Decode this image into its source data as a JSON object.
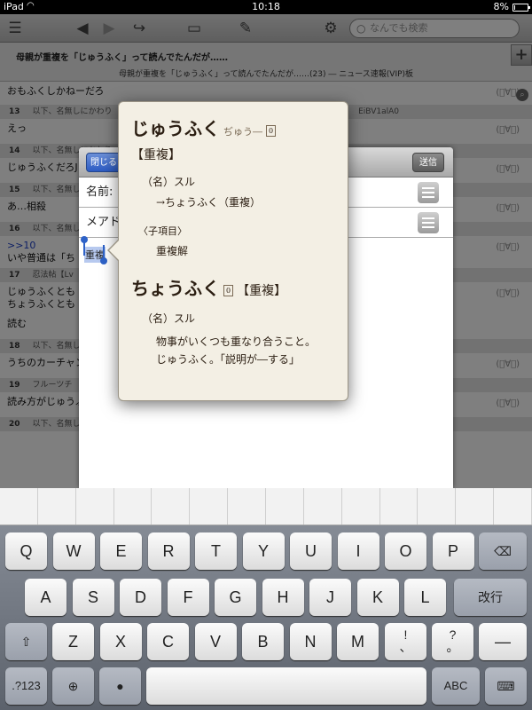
{
  "status": {
    "carrier": "iPad",
    "time": "10:18",
    "battery": "8%",
    "battery_level": 0.08
  },
  "toolbar": {
    "search_placeholder": "なんでも検索"
  },
  "thread": {
    "title": "母親が重複を「じゅうふく」って読んでたんだが……",
    "subtitle": "母親が重複を「じゅうふく」って読んでたんだが……(23) ― ニュース速報(VIP)板"
  },
  "posts": [
    {
      "head": null,
      "body": "おもふくしかねーだろ"
    },
    {
      "num": "13",
      "name": "以下、名無しにかわり",
      "pid": "EiBV1alA0",
      "body": "えっ"
    },
    {
      "num": "14",
      "name": "以下、名無しにかわり",
      "pid": "",
      "body": "じゅうふくだろJ"
    },
    {
      "num": "15",
      "name": "以下、名無しにかわり",
      "pid": "",
      "body": "あ…相殺"
    },
    {
      "num": "16",
      "name": "以下、名無しにかわり",
      "pid": "",
      "anchor": ">>10",
      "body": "いや普通は「ち"
    },
    {
      "num": "17",
      "name": "忍法帖【Lv",
      "pid": "",
      "body": "じゅうふくとも\nちょうふくとも"
    },
    {
      "num": "",
      "name": "",
      "pid": "",
      "body": "読む"
    },
    {
      "num": "18",
      "name": "以下、名無しにかわり",
      "pid": "",
      "body": "うちのカーチャン"
    },
    {
      "num": "19",
      "name": "フルーツチ",
      "pid": "",
      "body": "読み方がじゅうふ"
    },
    {
      "num": "20",
      "name": "以下、名無しにかわり",
      "pid": "",
      "body": ""
    }
  ],
  "compose": {
    "close_label": "閉じる",
    "send_label": "送信",
    "name_label": "名前:",
    "mail_label": "メアド",
    "body_text": "重複"
  },
  "dictionary": {
    "entry1": {
      "headword": "じゅうふく",
      "alt_reading": "ぢゅう―",
      "num": "0",
      "kanji": "【重複】",
      "pos": "（名）スル",
      "ref": "→ちょうふく（重複）",
      "sub_header": "〈子項目〉",
      "sub_item": "重複解"
    },
    "entry2": {
      "headword": "ちょうふく",
      "num": "0",
      "kanji": "【重複】",
      "pos": "（名）スル",
      "definition": "物事がいくつも重なり合うこと。じゅうふく。「説明が―する」"
    }
  },
  "keyboard": {
    "row1": [
      "Q",
      "W",
      "E",
      "R",
      "T",
      "Y",
      "U",
      "I",
      "O",
      "P"
    ],
    "row2": [
      "A",
      "S",
      "D",
      "F",
      "G",
      "H",
      "J",
      "K",
      "L"
    ],
    "row3": [
      "Z",
      "X",
      "C",
      "V",
      "B",
      "N",
      "M"
    ],
    "enter_label": "改行",
    "numbers_label": ".?123",
    "abc_label": "ABC",
    "exclaim": "!",
    "exclaim_sub": "、",
    "question": "?",
    "question_sub": "。",
    "dash": "―"
  }
}
